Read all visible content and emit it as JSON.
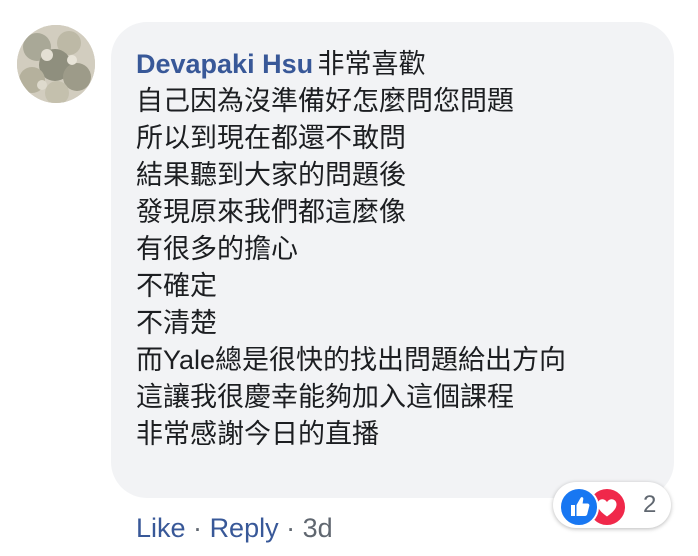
{
  "comment": {
    "author": "Devapaki Hsu",
    "first_line_text": "非常喜歡",
    "lines": [
      "自己因為沒準備好怎麼問您問題",
      "所以到現在都還不敢問",
      "結果聽到大家的問題後",
      "發現原來我們都這麼像",
      "有很多的擔心",
      "不確定",
      "不清楚",
      "而Yale總是很快的找出問題給出方向",
      "這讓我很慶幸能夠加入這個課程",
      "非常感謝今日的直播"
    ]
  },
  "reactions": {
    "count": "2",
    "icons": [
      "like-icon",
      "love-icon"
    ],
    "colors": {
      "like": "#1877f2",
      "love": "#f0284a"
    }
  },
  "actions": {
    "like_label": "Like",
    "separator": "·",
    "reply_label": "Reply",
    "timestamp": "3d"
  },
  "colors": {
    "link": "#385898",
    "text": "#1c1e21",
    "muted": "#606770",
    "bubble": "#f2f3f5"
  }
}
